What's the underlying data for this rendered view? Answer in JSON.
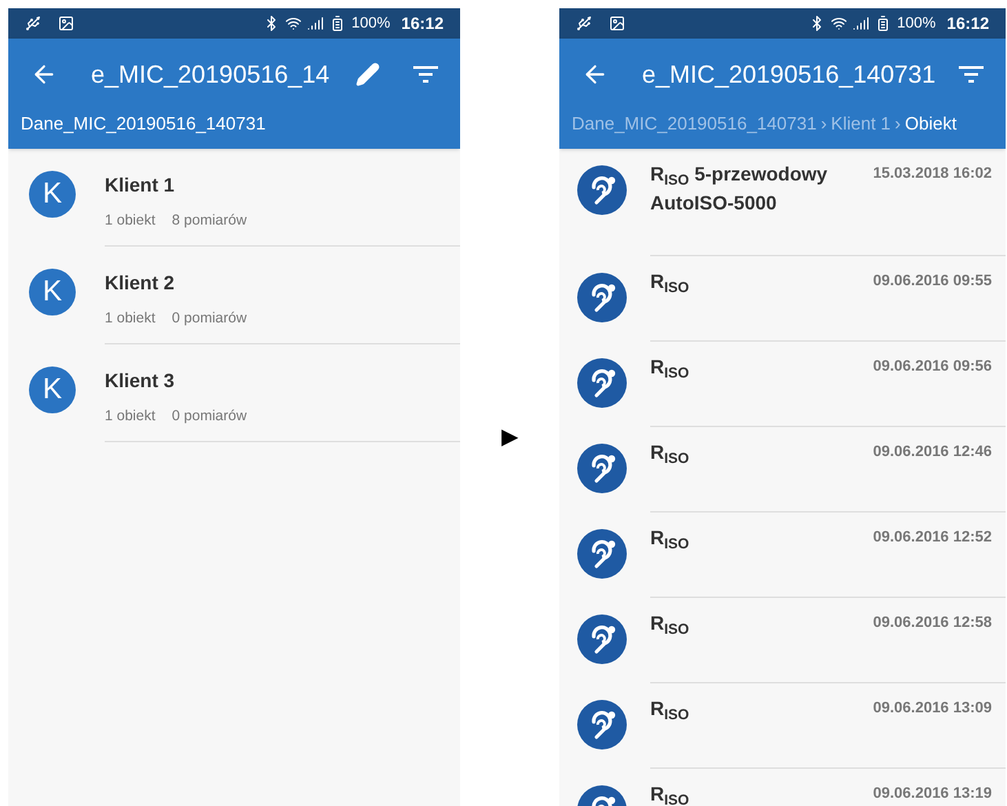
{
  "screens": [
    {
      "kind": "clients",
      "status_bar": {
        "battery": "100%",
        "time": "16:12"
      },
      "title": "e_MIC_20190516_14",
      "edit_button": true,
      "breadcrumb": [
        {
          "label": "Dane_MIC_20190516_140731",
          "current": true
        }
      ],
      "items": [
        {
          "avatar": "K",
          "name": "Klient 1",
          "objects": "1 obiekt",
          "measurements": "8 pomiarów"
        },
        {
          "avatar": "K",
          "name": "Klient 2",
          "objects": "1 obiekt",
          "measurements": "0 pomiarów"
        },
        {
          "avatar": "K",
          "name": "Klient 3",
          "objects": "1 obiekt",
          "measurements": "0 pomiarów"
        }
      ]
    },
    {
      "kind": "measurements",
      "status_bar": {
        "battery": "100%",
        "time": "16:12"
      },
      "title": "e_MIC_20190516_140731",
      "edit_button": false,
      "breadcrumb_separator": "›",
      "breadcrumb": [
        {
          "label": "Dane_MIC_20190516_140731",
          "current": false
        },
        {
          "label": "Klient 1",
          "current": false
        },
        {
          "label": "Obiekt",
          "current": true
        }
      ],
      "items": [
        {
          "title": "R$_{ISO}$ 5-przewodowy",
          "subtitle": "AutoISO-5000",
          "date": "15.03.2018 16:02"
        },
        {
          "title": "R$_{ISO}$",
          "date": "09.06.2016 09:55"
        },
        {
          "title": "R$_{ISO}$",
          "date": "09.06.2016 09:56"
        },
        {
          "title": "R$_{ISO}$",
          "date": "09.06.2016 12:46"
        },
        {
          "title": "R$_{ISO}$",
          "date": "09.06.2016 12:52"
        },
        {
          "title": "R$_{ISO}$",
          "date": "09.06.2016 12:58"
        },
        {
          "title": "R$_{ISO}$",
          "date": "09.06.2016 13:09"
        },
        {
          "title": "R$_{ISO}$",
          "date": "09.06.2016 13:19"
        }
      ]
    }
  ],
  "arrow": "▶"
}
